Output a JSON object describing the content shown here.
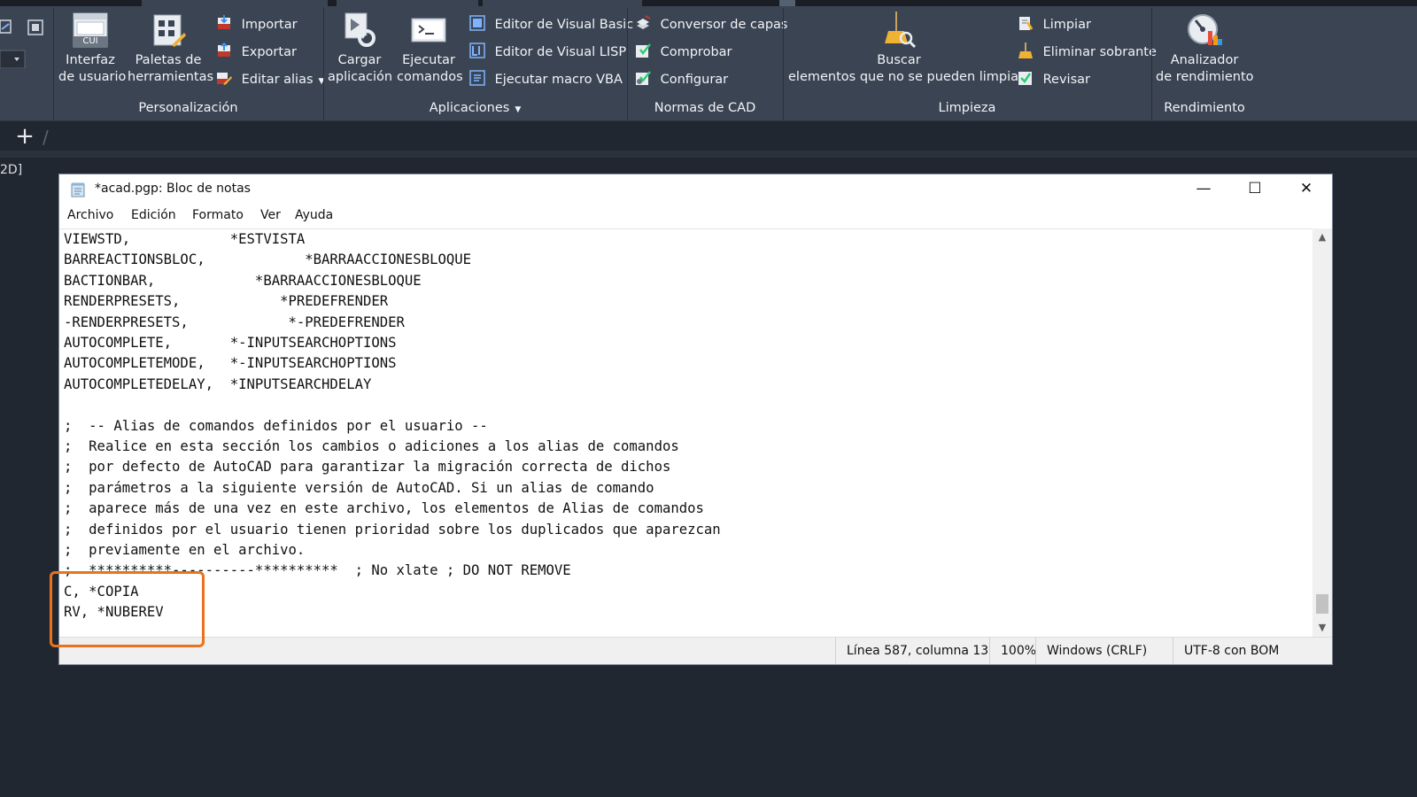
{
  "ribbon": {
    "panels": {
      "personalizacion": "Personalización",
      "aplicaciones": "Aplicaciones",
      "normas": "Normas de CAD",
      "limpieza": "Limpieza",
      "rendimiento": "Rendimiento"
    },
    "buttons": {
      "interfaz_line1": "Interfaz",
      "interfaz_line2": "de usuario",
      "cui_badge": "CUI",
      "paletas_line1": "Paletas de",
      "paletas_line2": "herramientas",
      "importar": "Importar",
      "exportar": "Exportar",
      "editar_alias": "Editar alias",
      "cargar_line1": "Cargar",
      "cargar_line2": "aplicación",
      "ejecutar_line1": "Ejecutar",
      "ejecutar_line2": "comandos",
      "editor_vb": "Editor de Visual Basic",
      "editor_lisp": "Editor de Visual LISP",
      "ejecutar_vba": "Ejecutar macro VBA",
      "conversor": "Conversor de capas",
      "comprobar": "Comprobar",
      "configurar": "Configurar",
      "buscar_line1": "Buscar",
      "buscar_line2": "elementos que no se pueden limpiar",
      "limpiar": "Limpiar",
      "eliminar_sobrante": "Eliminar sobrante",
      "revisar": "Revisar",
      "analizador_line1": "Analizador",
      "analizador_line2": "de rendimiento"
    }
  },
  "tabs": {
    "add": "+"
  },
  "viewport_label": "2D]",
  "notepad": {
    "title": "*acad.pgp: Bloc de notas",
    "window_controls": {
      "minimize": "—",
      "maximize": "☐",
      "close": "✕"
    },
    "menu": [
      "Archivo",
      "Edición",
      "Formato",
      "Ver",
      "Ayuda"
    ],
    "lines": [
      "VIEWSTD,            *ESTVISTA",
      "BARREACTIONSBLOC,            *BARRAACCIONESBLOQUE",
      "BACTIONBAR,            *BARRAACCIONESBLOQUE",
      "RENDERPRESETS,            *PREDEFRENDER",
      "-RENDERPRESETS,            *-PREDEFRENDER",
      "AUTOCOMPLETE,       *-INPUTSEARCHOPTIONS",
      "AUTOCOMPLETEMODE,   *-INPUTSEARCHOPTIONS",
      "AUTOCOMPLETEDELAY,  *INPUTSEARCHDELAY",
      "",
      ";  -- Alias de comandos definidos por el usuario --",
      ";  Realice en esta sección los cambios o adiciones a los alias de comandos",
      ";  por defecto de AutoCAD para garantizar la migración correcta de dichos",
      ";  parámetros a la siguiente versión de AutoCAD. Si un alias de comando",
      ";  aparece más de una vez en este archivo, los elementos de Alias de comandos",
      ";  definidos por el usuario tienen prioridad sobre los duplicados que aparezcan",
      ";  previamente en el archivo.",
      ";  **********----------**********  ; No xlate ; DO NOT REMOVE",
      "C, *COPIA",
      "RV, *NUBEREV"
    ],
    "status": {
      "position": "Línea 587, columna 13",
      "zoom": "100%",
      "line_ending": "Windows (CRLF)",
      "encoding": "UTF-8 con BOM"
    }
  },
  "colors": {
    "ribbon_bg": "#3b4453",
    "canvas_bg": "#212730",
    "highlight": "#e8731c"
  }
}
